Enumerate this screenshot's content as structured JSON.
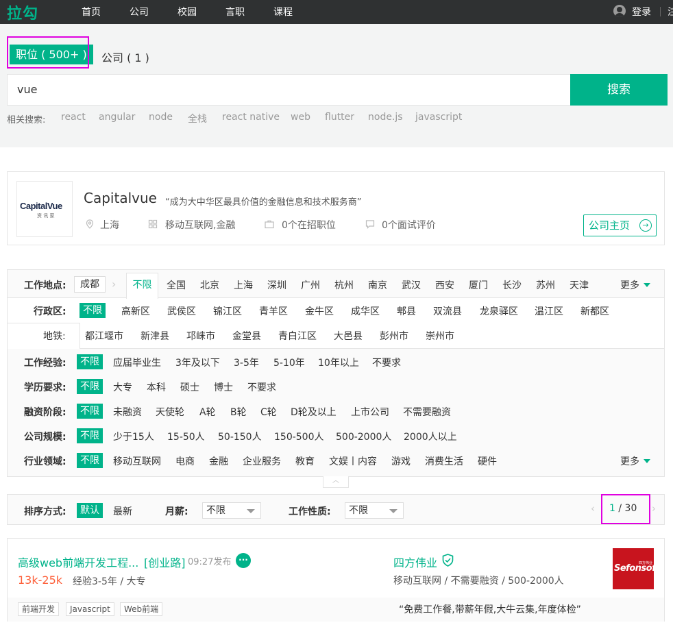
{
  "nav": {
    "logo": "拉勾",
    "links": [
      "首页",
      "公司",
      "校园",
      "言职",
      "课程"
    ],
    "login": "登录",
    "register": "注"
  },
  "search": {
    "tab_jobs": "职位 ( 500+ )",
    "tab_companies": "公司 ( 1 )",
    "query": "vue",
    "button": "搜索",
    "related_label": "相关搜索:",
    "related": [
      "react",
      "angular",
      "node",
      "全栈",
      "react native",
      "web",
      "flutter",
      "node.js",
      "javascript"
    ]
  },
  "company_card": {
    "logo_text": "CapitalVue",
    "logo_subtext": "资 讯 家",
    "name": "Capitalvue",
    "slogan": "“成为大中华区最具价值的金融信息和技术服务商”",
    "city": "上海",
    "industry": "移动互联网,金融",
    "jobs": "0个在招职位",
    "reviews": "0个面试评价",
    "home_button": "公司主页"
  },
  "filters": {
    "location": {
      "label": "工作地点:",
      "current_city": "成都",
      "unlimited": "不限",
      "cities": [
        "全国",
        "北京",
        "上海",
        "深圳",
        "广州",
        "杭州",
        "南京",
        "武汉",
        "西安",
        "厦门",
        "长沙",
        "苏州",
        "天津"
      ],
      "more": "更多"
    },
    "district": {
      "label": "行政区:",
      "selected": "不限",
      "row1": [
        "高新区",
        "武侯区",
        "锦江区",
        "青羊区",
        "金牛区",
        "成华区",
        "郫县",
        "双流县",
        "龙泉驿区",
        "温江区",
        "新都区"
      ],
      "metro_label": "地铁:",
      "row2": [
        "都江堰市",
        "新津县",
        "邛崃市",
        "金堂县",
        "青白江区",
        "大邑县",
        "彭州市",
        "崇州市"
      ]
    },
    "experience": {
      "label": "工作经验:",
      "selected": "不限",
      "options": [
        "应届毕业生",
        "3年及以下",
        "3-5年",
        "5-10年",
        "10年以上",
        "不要求"
      ]
    },
    "education": {
      "label": "学历要求:",
      "selected": "不限",
      "options": [
        "大专",
        "本科",
        "硕士",
        "博士",
        "不要求"
      ]
    },
    "funding": {
      "label": "融资阶段:",
      "selected": "不限",
      "options": [
        "未融资",
        "天使轮",
        "A轮",
        "B轮",
        "C轮",
        "D轮及以上",
        "上市公司",
        "不需要融资"
      ]
    },
    "size": {
      "label": "公司规模:",
      "selected": "不限",
      "options": [
        "少于15人",
        "15-50人",
        "50-150人",
        "150-500人",
        "500-2000人",
        "2000人以上"
      ]
    },
    "industry": {
      "label": "行业领域:",
      "selected": "不限",
      "options": [
        "移动互联网",
        "电商",
        "金融",
        "企业服务",
        "教育",
        "文娱丨内容",
        "游戏",
        "消费生活",
        "硬件"
      ],
      "more": "更多"
    }
  },
  "sort": {
    "label": "排序方式:",
    "default": "默认",
    "latest": "最新",
    "salary_label": "月薪:",
    "salary_value": "不限",
    "jobtype_label": "工作性质:",
    "jobtype_value": "不限",
    "page_current": "1",
    "page_rest": " / 30"
  },
  "job": {
    "title": "高级web前端开发工程...",
    "location": "[创业路]",
    "time": "09:27发布",
    "salary": "13k-25k",
    "requirements": "经验3-5年 / 大专",
    "tags": [
      "前端开发",
      "Javascript",
      "Web前端"
    ],
    "company": "四方伟业",
    "company_meta": "移动互联网 / 不需要融资 / 500-2000人",
    "welfare": "“免费工作餐,带薪年假,大牛云集,年度体检”",
    "logo_text": "Sefonsoft",
    "logo_subtext": "四方伟业"
  },
  "colors": {
    "accent": "#00b38a",
    "salary": "#fd5f39",
    "nav_bg": "#2f3132",
    "highlight_box": "#e000e0"
  }
}
